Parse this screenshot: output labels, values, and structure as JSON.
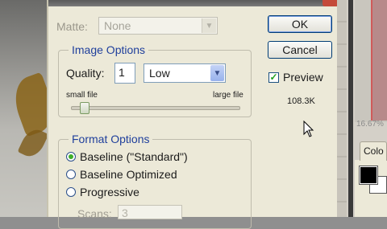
{
  "matte": {
    "label": "Matte:",
    "value": "None"
  },
  "image_options": {
    "title": "Image Options",
    "quality_label": "Quality:",
    "quality_value": "1",
    "level_value": "Low",
    "small_file_label": "small file",
    "large_file_label": "large file",
    "quality_slider_fraction": 0.0833
  },
  "format_options": {
    "title": "Format Options",
    "radios": [
      {
        "label": "Baseline (\"Standard\")",
        "checked": true
      },
      {
        "label": "Baseline Optimized",
        "checked": false
      },
      {
        "label": "Progressive",
        "checked": false
      }
    ],
    "scans_label": "Scans:",
    "scans_value": "3"
  },
  "buttons": {
    "ok": "OK",
    "cancel": "Cancel"
  },
  "preview": {
    "label": "Preview",
    "checked": true,
    "file_size": "108.3K"
  },
  "right_panel": {
    "zoom": "16.67%",
    "tab_color": "Colo"
  },
  "colors": {
    "group_title": "#1f3f9c",
    "button_border": "#003c74",
    "radio_checked": "#3fae2a"
  }
}
